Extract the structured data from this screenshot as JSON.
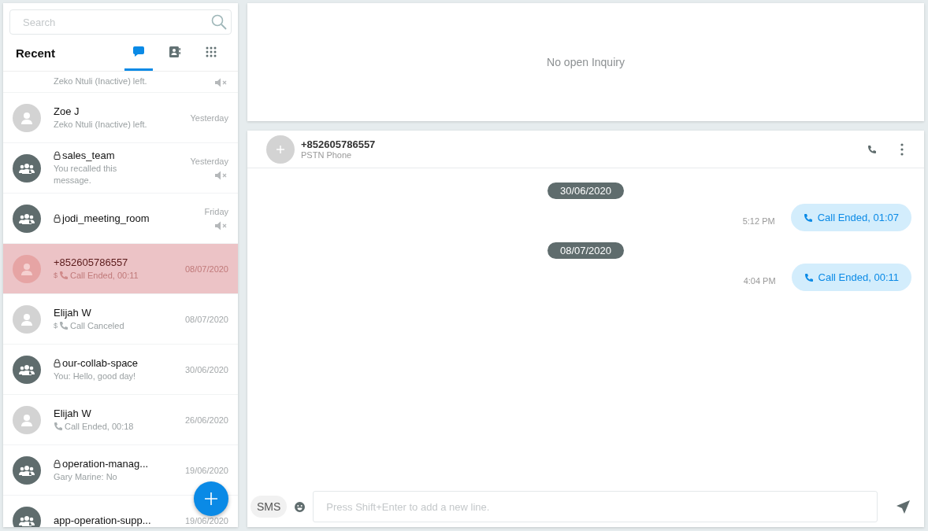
{
  "sidebar": {
    "search": {
      "placeholder": "Search"
    },
    "title": "Recent",
    "tabs": [
      {
        "kind": "chats",
        "selected": true
      },
      {
        "kind": "contacts",
        "selected": false
      },
      {
        "kind": "apps",
        "selected": false
      }
    ],
    "items": [
      {
        "kind": "partial",
        "preview": "Zeko Ntuli (Inactive) left.",
        "muted": true,
        "selected": false
      },
      {
        "kind": "person",
        "name": "Zoe J",
        "preview": "Zeko Ntuli (Inactive) left.",
        "time": "Yesterday",
        "muted": false,
        "selected": false
      },
      {
        "kind": "group",
        "locked": true,
        "name": "sales_team",
        "preview": "You recalled this message.",
        "time": "Yesterday",
        "muted": true,
        "selected": false
      },
      {
        "kind": "group",
        "locked": true,
        "name": "jodi_meeting_room",
        "time": "Friday",
        "muted": true,
        "selected": false
      },
      {
        "kind": "person",
        "name": "+852605786557",
        "call": true,
        "call_prefix": "$",
        "preview": "Call Ended, 00:11",
        "time": "08/07/2020",
        "muted": false,
        "selected": true
      },
      {
        "kind": "person",
        "name": "Elijah W",
        "call": true,
        "call_prefix": "$",
        "preview": "Call Canceled",
        "time": "08/07/2020",
        "muted": false,
        "selected": false
      },
      {
        "kind": "group",
        "locked": true,
        "name": "our-collab-space",
        "preview": "You: Hello, good day!",
        "time": "30/06/2020",
        "muted": false,
        "selected": false
      },
      {
        "kind": "person",
        "name": "Elijah W",
        "call": true,
        "preview": "Call Ended, 00:18",
        "time": "26/06/2020",
        "muted": false,
        "selected": false
      },
      {
        "kind": "group",
        "locked": true,
        "name": "operation-manag...",
        "preview": "Gary Marine: No",
        "time": "19/06/2020",
        "muted": false,
        "selected": false
      },
      {
        "kind": "group",
        "name": "app-operation-supp...",
        "time": "19/06/2020",
        "muted": false,
        "selected": false
      }
    ]
  },
  "inquiry": {
    "text": "No open Inquiry"
  },
  "chat": {
    "name": "+852605786557",
    "subtitle": "PSTN Phone",
    "messages": [
      {
        "kind": "date",
        "text": "30/06/2020"
      },
      {
        "kind": "call",
        "time": "5:12 PM",
        "text": "Call Ended, 01:07"
      },
      {
        "kind": "date",
        "text": "08/07/2020"
      },
      {
        "kind": "call",
        "time": "4:04 PM",
        "text": "Call Ended, 00:11"
      }
    ],
    "composer": {
      "mode": "SMS",
      "placeholder": "Press Shift+Enter to add a new line."
    }
  }
}
